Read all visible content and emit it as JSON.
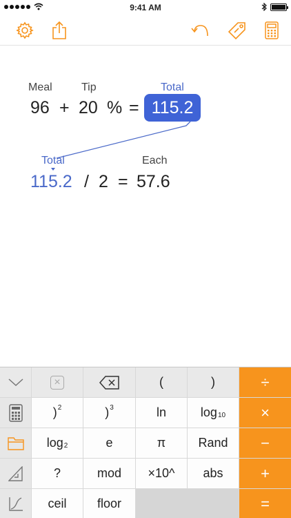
{
  "status_bar": {
    "time": "9:41 AM"
  },
  "toolbar": {
    "icons": [
      "gear-icon",
      "share-icon",
      "undo-icon",
      "tag-icon",
      "calculator-icon"
    ],
    "accent_color": "#f7941d"
  },
  "worksheet": {
    "line1": {
      "meal_label": "Meal",
      "tip_label": "Tip",
      "total_label": "Total",
      "meal_value": "96",
      "plus": "+",
      "tip_value": "20",
      "percent": "%",
      "equals": "=",
      "result": "115.2"
    },
    "line2": {
      "total_ref_label": "Total",
      "each_label": "Each",
      "total_ref_value": "115.2",
      "divide": "/",
      "divisor": "2",
      "equals": "=",
      "result": "57.6"
    },
    "highlight_color": "#3f63d6",
    "reference_color": "#4a69c9"
  },
  "keypad": {
    "row1": {
      "clear": "×",
      "lparen": "(",
      "rparen": ")",
      "divide": "÷"
    },
    "row2": {
      "square": ")",
      "square_exp": "2",
      "cube": ")",
      "cube_exp": "3",
      "ln": "ln",
      "log10": "log",
      "log10_sub": "10",
      "multiply": "×"
    },
    "row3": {
      "log2": "log",
      "log2_sub": "2",
      "e": "e",
      "pi": "π",
      "rand": "Rand",
      "minus": "−"
    },
    "row4": {
      "question": "?",
      "mod": "mod",
      "times10": "×10^",
      "abs": "abs",
      "plus": "+"
    },
    "row5": {
      "ceil": "ceil",
      "floor": "floor",
      "equals": "="
    },
    "side_icons": [
      "collapse-chevron-icon",
      "keypad-grid-icon",
      "folder-icon",
      "triangle-ruler-icon",
      "function-graph-icon"
    ]
  }
}
